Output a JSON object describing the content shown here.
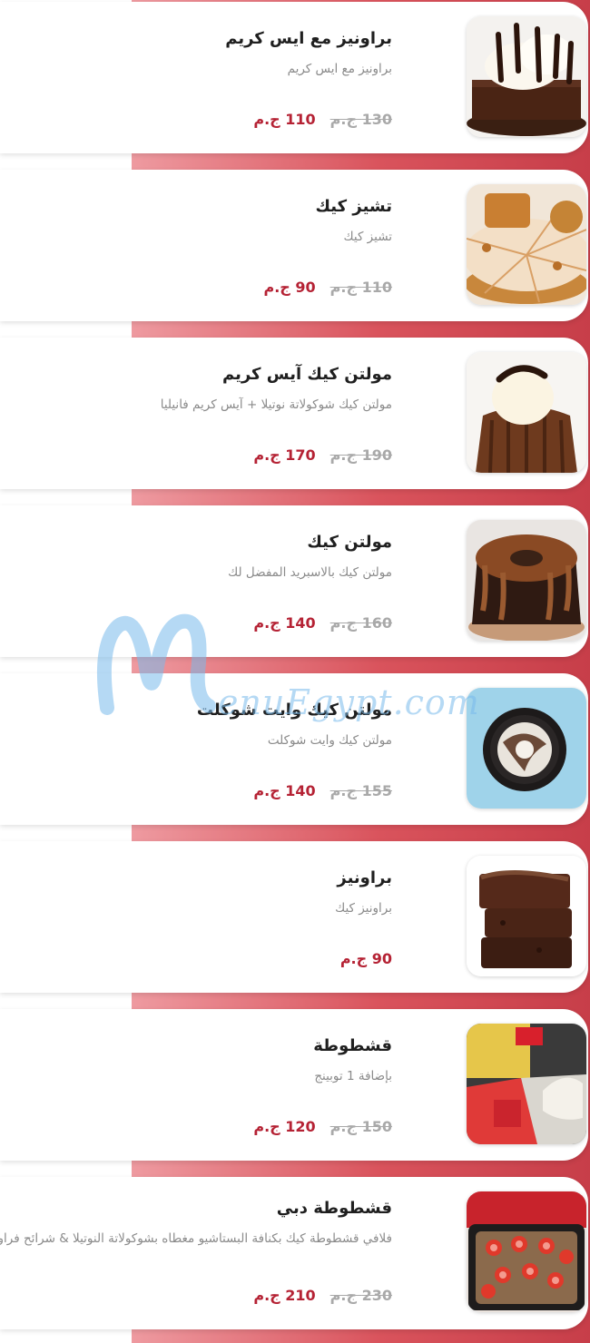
{
  "currency": "ج.م",
  "items": [
    {
      "title": "براونيز مع ايس كريم",
      "desc": "براونيز مع ايس كريم",
      "price_old": "130",
      "price_new": "110",
      "image": "brownie-ice-cream-photo"
    },
    {
      "title": "تشيز كيك",
      "desc": "تشيز كيك",
      "price_old": "110",
      "price_new": "90",
      "image": "lotus-cheesecake-photo"
    },
    {
      "title": "مولتن كيك آيس كريم",
      "desc": "مولتن كيك شوكولاتة نوتيلا + آيس كريم فانيليا",
      "price_old": "190",
      "price_new": "170",
      "image": "molten-cake-ice-cream-photo"
    },
    {
      "title": "مولتن كيك",
      "desc": "مولتن كيك بالاسبريد المفضل لك",
      "price_old": "160",
      "price_new": "140",
      "image": "molten-cake-photo"
    },
    {
      "title": "مولتن كيك وايت شوكلت",
      "desc": "مولتن كيك وايت شوكلت",
      "price_old": "155",
      "price_new": "140",
      "image": "white-chocolate-molten-photo"
    },
    {
      "title": "براونيز",
      "desc": "براونيز كيك",
      "price_old": "",
      "price_new": "90",
      "image": "brownies-stack-photo"
    },
    {
      "title": "قشطوطة",
      "desc": "بإضافة 1 توبينج",
      "price_old": "150",
      "price_new": "120",
      "image": "ashtota-photo"
    },
    {
      "title": "قشطوطة دبي",
      "desc": "فلافي قشطوطة كيك بكنافة البستاشيو مغطاه بشوكولاتة النوتيلا & شرائح فراولة فريش",
      "price_old": "230",
      "price_new": "210",
      "image": "dubai-ashtota-photo"
    }
  ],
  "watermark": {
    "script": "M",
    "text": "enuEgypt.com"
  }
}
